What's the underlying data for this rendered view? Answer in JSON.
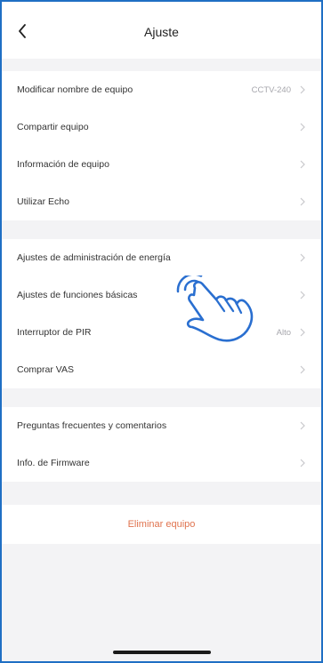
{
  "header": {
    "title": "Ajuste",
    "back_icon": "chevron-left-icon"
  },
  "sections": [
    {
      "rows": [
        {
          "label": "Modificar nombre de equipo",
          "value": "CCTV-240"
        },
        {
          "label": "Compartir equipo",
          "value": ""
        },
        {
          "label": "Información de equipo",
          "value": ""
        },
        {
          "label": "Utilizar Echo",
          "value": ""
        }
      ]
    },
    {
      "rows": [
        {
          "label": "Ajustes de administración de energía",
          "value": ""
        },
        {
          "label": "Ajustes de funciones básicas",
          "value": ""
        },
        {
          "label": "Interruptor de PIR",
          "value": "Alto"
        },
        {
          "label": "Comprar VAS",
          "value": ""
        }
      ]
    },
    {
      "rows": [
        {
          "label": "Preguntas frecuentes y comentarios",
          "value": ""
        },
        {
          "label": "Info. de Firmware",
          "value": ""
        }
      ]
    }
  ],
  "delete_button": {
    "label": "Eliminar equipo"
  },
  "overlay": {
    "icon": "tap-hand-icon"
  },
  "colors": {
    "frame": "#1f6fc4",
    "danger": "#e0734e",
    "background": "#f3f3f5",
    "hand": "#2a6fd0"
  }
}
